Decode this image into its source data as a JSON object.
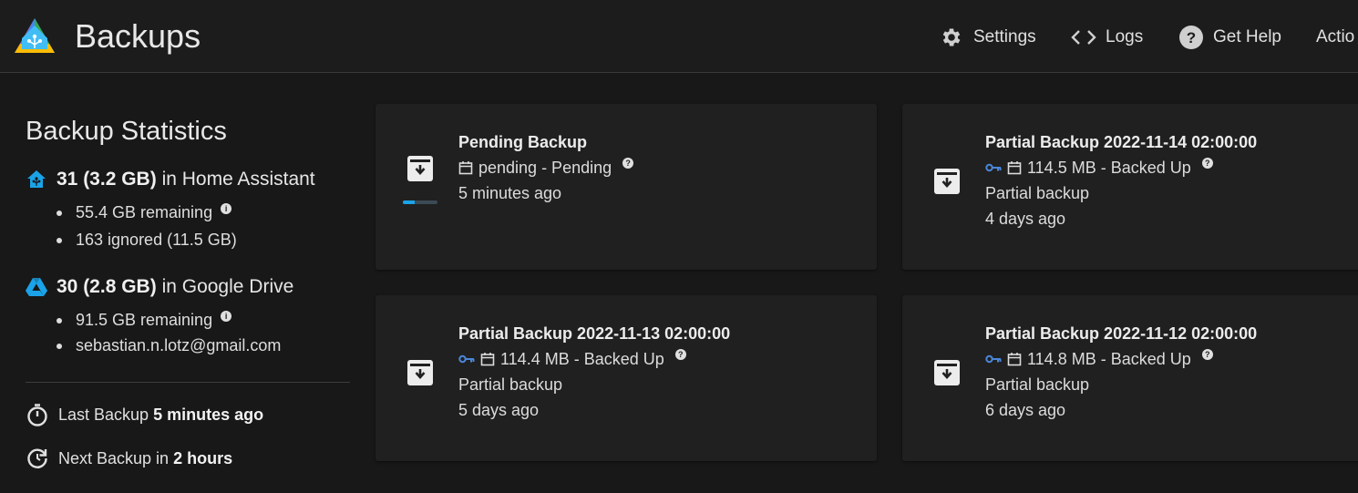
{
  "header": {
    "title": "Backups",
    "nav": {
      "settings": "Settings",
      "logs": "Logs",
      "help": "Get Help",
      "actions": "Actio"
    }
  },
  "stats": {
    "title": "Backup Statistics",
    "home_assistant": {
      "count": "31 (3.2 GB)",
      "location": "in Home Assistant",
      "remaining": "55.4 GB remaining",
      "ignored": "163 ignored (11.5 GB)"
    },
    "google_drive": {
      "count": "30 (2.8 GB)",
      "location": "in Google Drive",
      "remaining": "91.5 GB remaining",
      "account": "sebastian.n.lotz@gmail.com"
    },
    "last_backup_label": "Last Backup",
    "last_backup_value": "5 minutes ago",
    "next_backup_label": "Next Backup in",
    "next_backup_value": "2 hours"
  },
  "cards": [
    {
      "title": "Pending Backup",
      "status": "pending - Pending",
      "line2": "5 minutes ago",
      "line3": "",
      "progress": 0.35
    },
    {
      "title": "Partial Backup 2022-11-14 02:00:00",
      "status": "114.5 MB - Backed Up",
      "line2": "Partial backup",
      "line3": "4 days ago"
    },
    {
      "title": "Partial Backup 2022-11-13 02:00:00",
      "status": "114.4 MB - Backed Up",
      "line2": "Partial backup",
      "line3": "5 days ago"
    },
    {
      "title": "Partial Backup 2022-11-12 02:00:00",
      "status": "114.8 MB - Backed Up",
      "line2": "Partial backup",
      "line3": "6 days ago"
    }
  ],
  "colors": {
    "accent": "#1aa3e8",
    "key_icon": "#4a86d8",
    "background": "#181818",
    "card": "#202020"
  }
}
